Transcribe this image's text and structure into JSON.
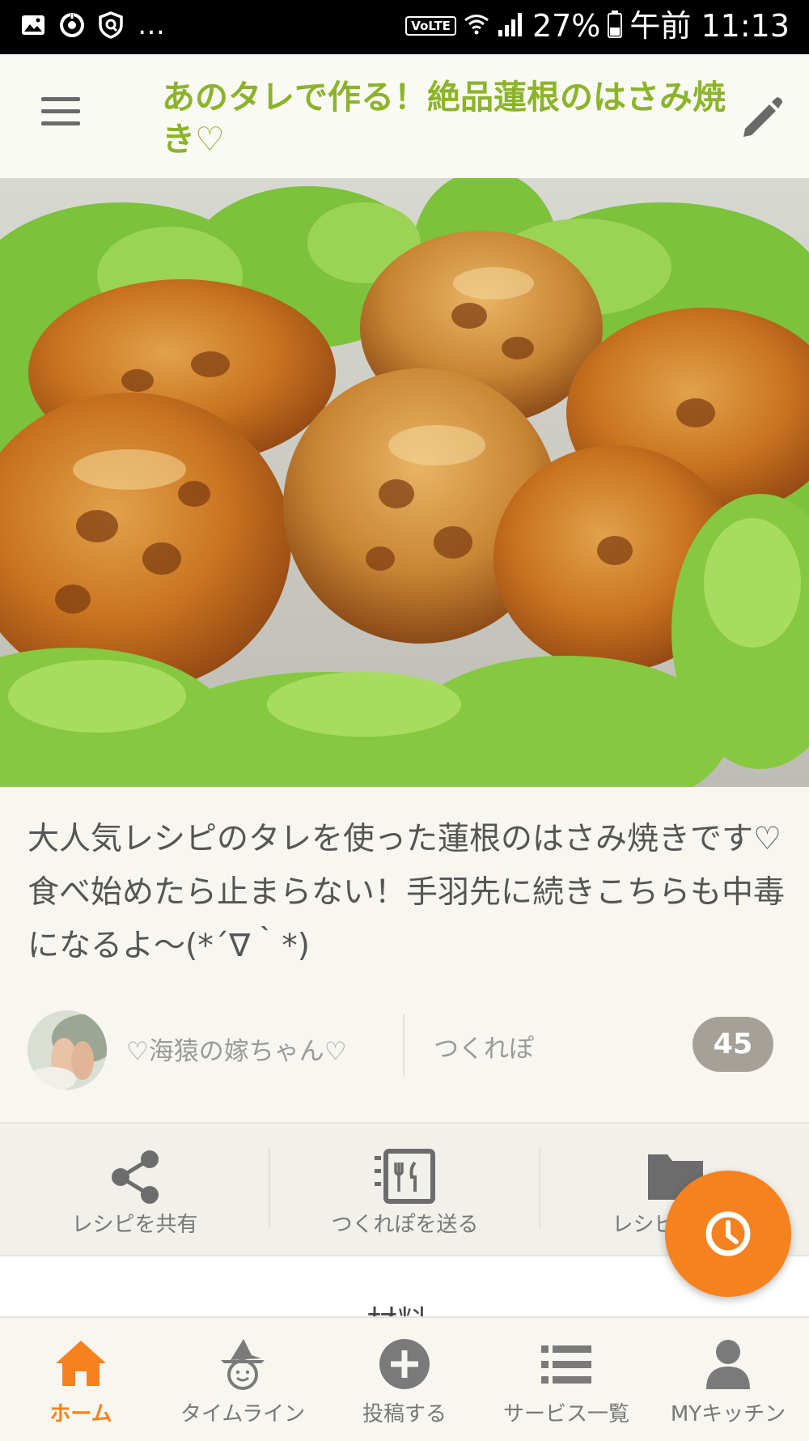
{
  "status_bar": {
    "left_icons": [
      "image-icon",
      "data-saver-icon",
      "shield-icon"
    ],
    "more": "…",
    "volte": "VoLTE",
    "battery": "27%",
    "time": "午前 11:13"
  },
  "app_bar": {
    "menu_icon": "hamburger-menu-icon",
    "title": "あのタレで作る！絶品蓮根のはさみ焼き♡",
    "edit_icon": "pencil-icon",
    "accent_color": "#8cb42a"
  },
  "hero": {
    "alt": "蓮根のはさみ焼き"
  },
  "description": "大人気レシピのタレを使った蓮根のはさみ焼きです♡食べ始めたら止まらない！手羽先に続きこちらも中毒になるよ～(*´∇｀*)",
  "author": {
    "name": "♡海猿の嫁ちゃん♡",
    "tsukurepo_label": "つくれぽ",
    "tsukurepo_count": "45"
  },
  "actions": [
    {
      "icon": "share-icon",
      "label": "レシピを共有"
    },
    {
      "icon": "send-tsukurepo-icon",
      "label": "つくれぽを送る"
    },
    {
      "icon": "folder-icon",
      "label": "レシピを保存"
    }
  ],
  "section_peek": "材料",
  "fab": {
    "icon": "clock-icon",
    "color": "#f6821f"
  },
  "bottom_nav": [
    {
      "icon": "home-icon",
      "label": "ホーム",
      "active": true
    },
    {
      "icon": "timeline-witch-icon",
      "label": "タイムライン",
      "active": false
    },
    {
      "icon": "plus-circle-icon",
      "label": "投稿する",
      "active": false
    },
    {
      "icon": "list-icon",
      "label": "サービス一覧",
      "active": false
    },
    {
      "icon": "person-icon",
      "label": "MYキッチン",
      "active": false
    }
  ],
  "colors": {
    "active": "#f6821f",
    "inactive": "#777777",
    "background": "#f7f6f0"
  }
}
